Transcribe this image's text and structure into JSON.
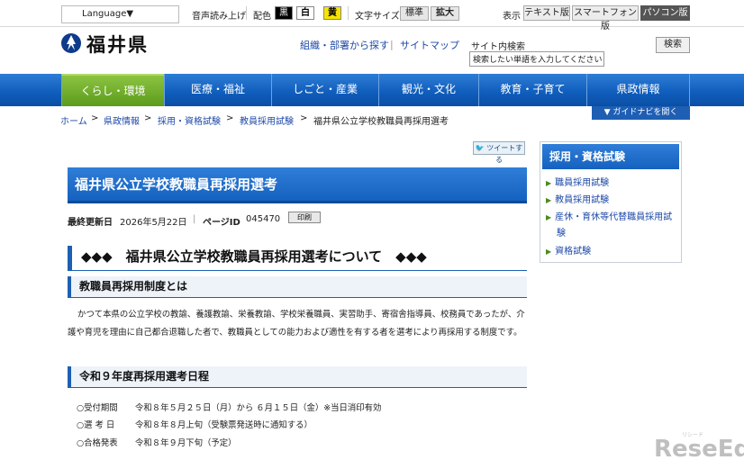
{
  "utility": {
    "language": "Language▼",
    "voice": "音声読み上げ",
    "color_label": "配色",
    "color_black": "黒",
    "color_white": "白",
    "color_yellow": "黄",
    "size_label": "文字サイズ",
    "size_normal": "標準",
    "size_large": "拡大",
    "display_label": "表示",
    "display_text": "テキスト版",
    "display_smartphone": "スマートフォン版",
    "display_pc": "パソコン版"
  },
  "header": {
    "logo": "福井県",
    "org_link": "組織・部署から探す",
    "sitemap": "サイトマップ",
    "search_label": "サイト内検索",
    "search_placeholder": "検索したい単語を入力してください",
    "search_button": "検索"
  },
  "nav": {
    "items": [
      "くらし・環境",
      "医療・福祉",
      "しごと・産業",
      "観光・文化",
      "教育・子育て",
      "県政情報"
    ],
    "guide": "▼ ガイドナビを開く"
  },
  "breadcrumb": [
    "ホーム",
    "県政情報",
    "採用・資格試験",
    "教員採用試験",
    "福井県公立学校教職員再採用選考"
  ],
  "breadcrumb_sep": ">",
  "page": {
    "tweet": "ツイートする",
    "title": "福井県公立学校教職員再採用選考",
    "updated_label": "最終更新日",
    "updated": "2026年5月22日",
    "pageid_label": "ページID",
    "pageid": "045470",
    "print": "印刷",
    "heading": "◆◆◆　福井県公立学校教職員再採用選考について　◆◆◆",
    "section1": "教職員再採用制度とは",
    "para": "かつて本県の公立学校の教諭、養護教諭、栄養教諭、学校栄養職員、実習助手、寄宿舎指導員、校務員であったが、介護や育児を理由に自己都合退職した者で、教職員としての能力および適性を有する者を選考により再採用する制度です。",
    "section2": "令和９年度再採用選考日程",
    "schedule": [
      {
        "k": "○受付期間",
        "v": "令和８年５月２５日（月）から ６月１５日（金）※当日消印有効"
      },
      {
        "k": "○選 考 日",
        "v": "令和８年８月上旬（受験票発送時に通知する）"
      },
      {
        "k": "○合格発表",
        "v": "令和８年９月下旬（予定）"
      }
    ]
  },
  "sidebar": {
    "title": "採用・資格試験",
    "items": [
      "職員採用試験",
      "教員採用試験",
      "産休・育休等代替職員採用試験",
      "資格試験"
    ]
  },
  "watermark": {
    "main": "ReseEd",
    "small": "リシード"
  },
  "colors": {
    "nav_blue": "#0f5cbb",
    "nav_active": "#5c9b1c",
    "link": "#1f4aa8"
  }
}
